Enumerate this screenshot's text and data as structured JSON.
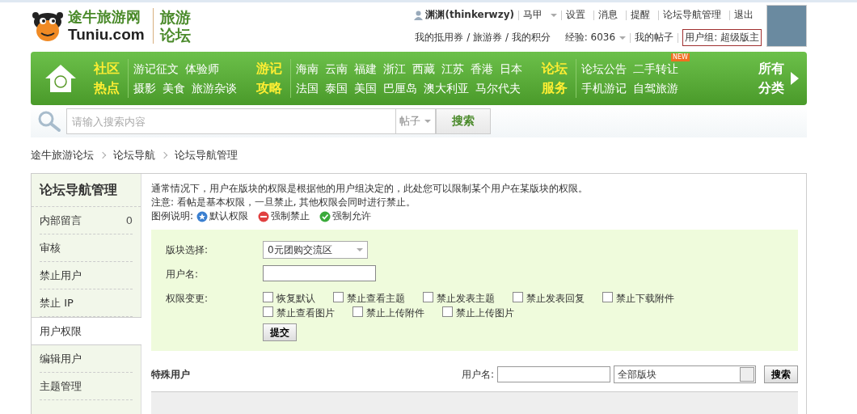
{
  "header": {
    "logo_text": "途牛旅游网",
    "logo_domain": "Tuniu.com",
    "forum_title": [
      "旅游",
      "论坛"
    ],
    "user": {
      "name": "渊渊(thinkerwzy)",
      "links": [
        {
          "label": "马甲",
          "dropdown": true
        },
        {
          "label": "设置",
          "dropdown": false
        },
        {
          "label": "消息",
          "dropdown": false
        },
        {
          "label": "提醒",
          "dropdown": false
        },
        {
          "label": "论坛导航管理",
          "dropdown": false
        },
        {
          "label": "退出",
          "dropdown": false
        }
      ]
    },
    "second_row": {
      "coupons": "我的抵用券 / 旅游券 / 我的积分",
      "exp": "经验: 6036",
      "posts": "我的帖子",
      "group": "用户组: 超级版主"
    }
  },
  "nav": {
    "groups": [
      {
        "title": [
          "社区",
          "热点"
        ],
        "upper": [
          "游记征文",
          "体验师"
        ],
        "lower": [
          "摄影",
          "美食",
          "旅游杂谈"
        ]
      },
      {
        "title": [
          "游记",
          "攻略"
        ],
        "upper": [
          "海南",
          "云南",
          "福建",
          "浙江",
          "西藏",
          "江苏",
          "香港",
          "日本"
        ],
        "lower": [
          "法国",
          "泰国",
          "美国",
          "巴厘岛",
          "澳大利亚",
          "马尔代夫"
        ]
      },
      {
        "title": [
          "论坛",
          "服务"
        ],
        "upper": [
          "论坛公告",
          "二手转让"
        ],
        "lower": [
          "手机游记",
          "自驾旅游"
        ],
        "badge": "NEW"
      }
    ],
    "all": [
      "所有",
      "分类"
    ]
  },
  "search": {
    "placeholder": "请输入搜索内容",
    "scope": "帖子",
    "button": "搜索"
  },
  "breadcrumb": [
    "途牛旅游论坛",
    "论坛导航",
    "论坛导航管理"
  ],
  "sidebar": {
    "title": "论坛导航管理",
    "items": [
      {
        "label": "内部留言",
        "count": "0",
        "selected": false
      },
      {
        "label": "审核",
        "selected": false
      },
      {
        "label": "禁止用户",
        "selected": false
      },
      {
        "label": "禁止 IP",
        "selected": false
      },
      {
        "label": "用户权限",
        "selected": true
      },
      {
        "label": "编辑用户",
        "selected": false
      },
      {
        "label": "主题管理",
        "selected": false
      }
    ]
  },
  "intro": [
    "通常情况下，用户在版块的权限是根据他的用户组决定的，此处您可以限制某个用户在某版块的权限。",
    "注意: 看帖是基本权限，一旦禁止, 其他权限会同时进行禁止。"
  ],
  "legend": {
    "label": "图例说明:",
    "items": [
      {
        "kind": "default",
        "text": "默认权限"
      },
      {
        "kind": "deny",
        "text": "强制禁止"
      },
      {
        "kind": "allow",
        "text": "强制允许"
      }
    ]
  },
  "form": {
    "forum_label": "版块选择:",
    "forum_value": "0元团购交流区",
    "user_label": "用户名:",
    "perm_label": "权限变更:",
    "options": [
      {
        "label": "恢复默认",
        "checked": false
      },
      {
        "label": "禁止查看主题",
        "checked": false
      },
      {
        "label": "禁止发表主题",
        "checked": false
      },
      {
        "label": "禁止发表回复",
        "checked": false
      },
      {
        "label": "禁止下载附件",
        "checked": false
      },
      {
        "label": "禁止查看图片",
        "checked": false
      },
      {
        "label": "禁止上传附件",
        "checked": false
      },
      {
        "label": "禁止上传图片",
        "checked": false
      }
    ],
    "submit": "提交"
  },
  "special": {
    "title": "特殊用户",
    "user_label": "用户名:",
    "forum_value": "全部版块",
    "button": "搜索"
  }
}
